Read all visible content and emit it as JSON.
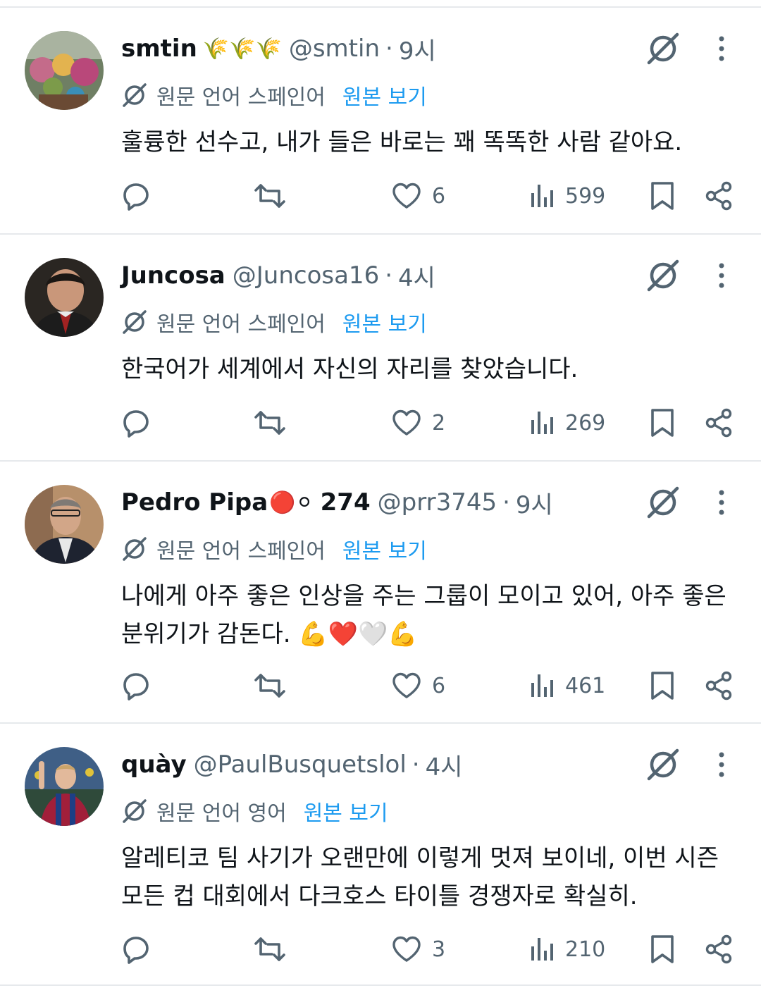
{
  "translate_prefix_es": "원문 언어 스페인어",
  "translate_prefix_en": "원문 언어 영어",
  "show_original": "원본 보기",
  "tweets": [
    {
      "name": "smtin",
      "name_emoji": "🌾🌾🌾",
      "handle": "@smtin",
      "time": "9시",
      "source_language_label": "원문 언어 스페인어",
      "text": "훌륭한 선수고, 내가 들은 바로는 꽤 똑똑한 사람 같아요.",
      "likes": "6",
      "views": "599"
    },
    {
      "name": "Juncosa",
      "name_emoji": "",
      "handle": "@Juncosa16",
      "time": "4시",
      "source_language_label": "원문 언어 스페인어",
      "text": "한국어가 세계에서 자신의 자리를 찾았습니다.",
      "likes": "2",
      "views": "269"
    },
    {
      "name": "Pedro Pipa",
      "name_emoji": "🔴⚪",
      "name_suffix": "274",
      "handle": "@prr3745",
      "time": "9시",
      "source_language_label": "원문 언어 스페인어",
      "text": "나에게 아주 좋은 인상을 주는 그룹이 모이고 있어, 아주 좋은 분위기가 감돈다. 💪❤️🤍💪",
      "likes": "6",
      "views": "461"
    },
    {
      "name": "quày",
      "name_emoji": "",
      "handle": "@PaulBusquetslol",
      "time": "4시",
      "source_language_label": "원문 언어 영어",
      "text": "알레티코 팀 사기가 오랜만에 이렇게 멋져 보이네, 이번 시즌 모든 컵 대회에서 다크호스 타이틀 경쟁자로 확실히.",
      "likes": "3",
      "views": "210"
    }
  ],
  "colors": {
    "text": "#0f1419",
    "secondary": "#536471",
    "link": "#1d9bf0",
    "divider": "#e6e9ec"
  }
}
